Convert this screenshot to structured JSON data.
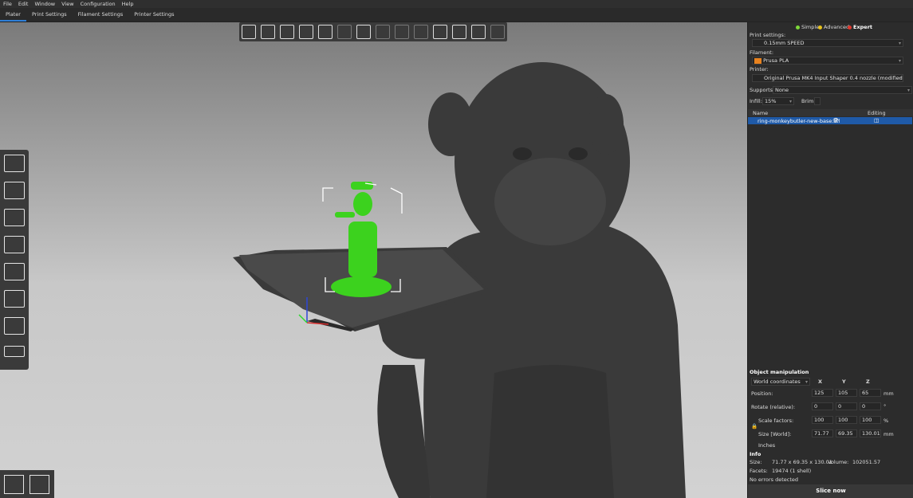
{
  "menu": [
    "File",
    "Edit",
    "Window",
    "View",
    "Configuration",
    "Help"
  ],
  "tabs": [
    "Plater",
    "Print Settings",
    "Filament Settings",
    "Printer Settings"
  ],
  "mode": {
    "simple": "Simple",
    "advanced": "Advanced",
    "expert": "Expert",
    "colors": {
      "simple": "#7dd83a",
      "advanced": "#e8c21b",
      "expert": "#e2382d"
    }
  },
  "print_settings": {
    "label": "Print settings:",
    "value": "0.15mm SPEED"
  },
  "filament": {
    "label": "Filament:",
    "value": "Prusa PLA",
    "color": "#e8821e"
  },
  "printer": {
    "label": "Printer:",
    "value": "Original Prusa MK4 Input Shaper 0.4 nozzle (modified)"
  },
  "supports": {
    "label": "Supports:",
    "value": "None"
  },
  "infill": {
    "label": "Infill:",
    "value": "15%",
    "brim_label": "Brim:"
  },
  "object_list": {
    "col_name": "Name",
    "col_editing": "Editing",
    "row": "ring-monkeybutler-new-base.stl"
  },
  "object_manipulation": {
    "title": "Object manipulation",
    "coords": "World coordinates",
    "x": "X",
    "y": "Y",
    "z": "Z",
    "position_label": "Position:",
    "position": [
      "125",
      "105",
      "65"
    ],
    "position_unit": "mm",
    "rotate_label": "Rotate (relative):",
    "rotate": [
      "0",
      "0",
      "0"
    ],
    "rotate_unit": "°",
    "scale_label": "Scale factors:",
    "scale": [
      "100",
      "100",
      "100"
    ],
    "scale_unit": "%",
    "size_label": "Size [World]:",
    "size": [
      "71.77",
      "69.35",
      "130.01"
    ],
    "size_unit": "mm",
    "inches_label": "Inches"
  },
  "info": {
    "title": "Info",
    "size_label": "Size:",
    "size_value": "71.77 x 69.35 x 130.01",
    "volume_label": "Volume:",
    "volume_value": "102051.57",
    "facets_label": "Facets:",
    "facets_value": "19474 (1 shell)",
    "errors": "No errors detected"
  },
  "slice_button": "Slice now",
  "colors": {
    "accent": "#2e7fd8",
    "model": "#3cd21e",
    "selection": "#1f5aa8"
  }
}
